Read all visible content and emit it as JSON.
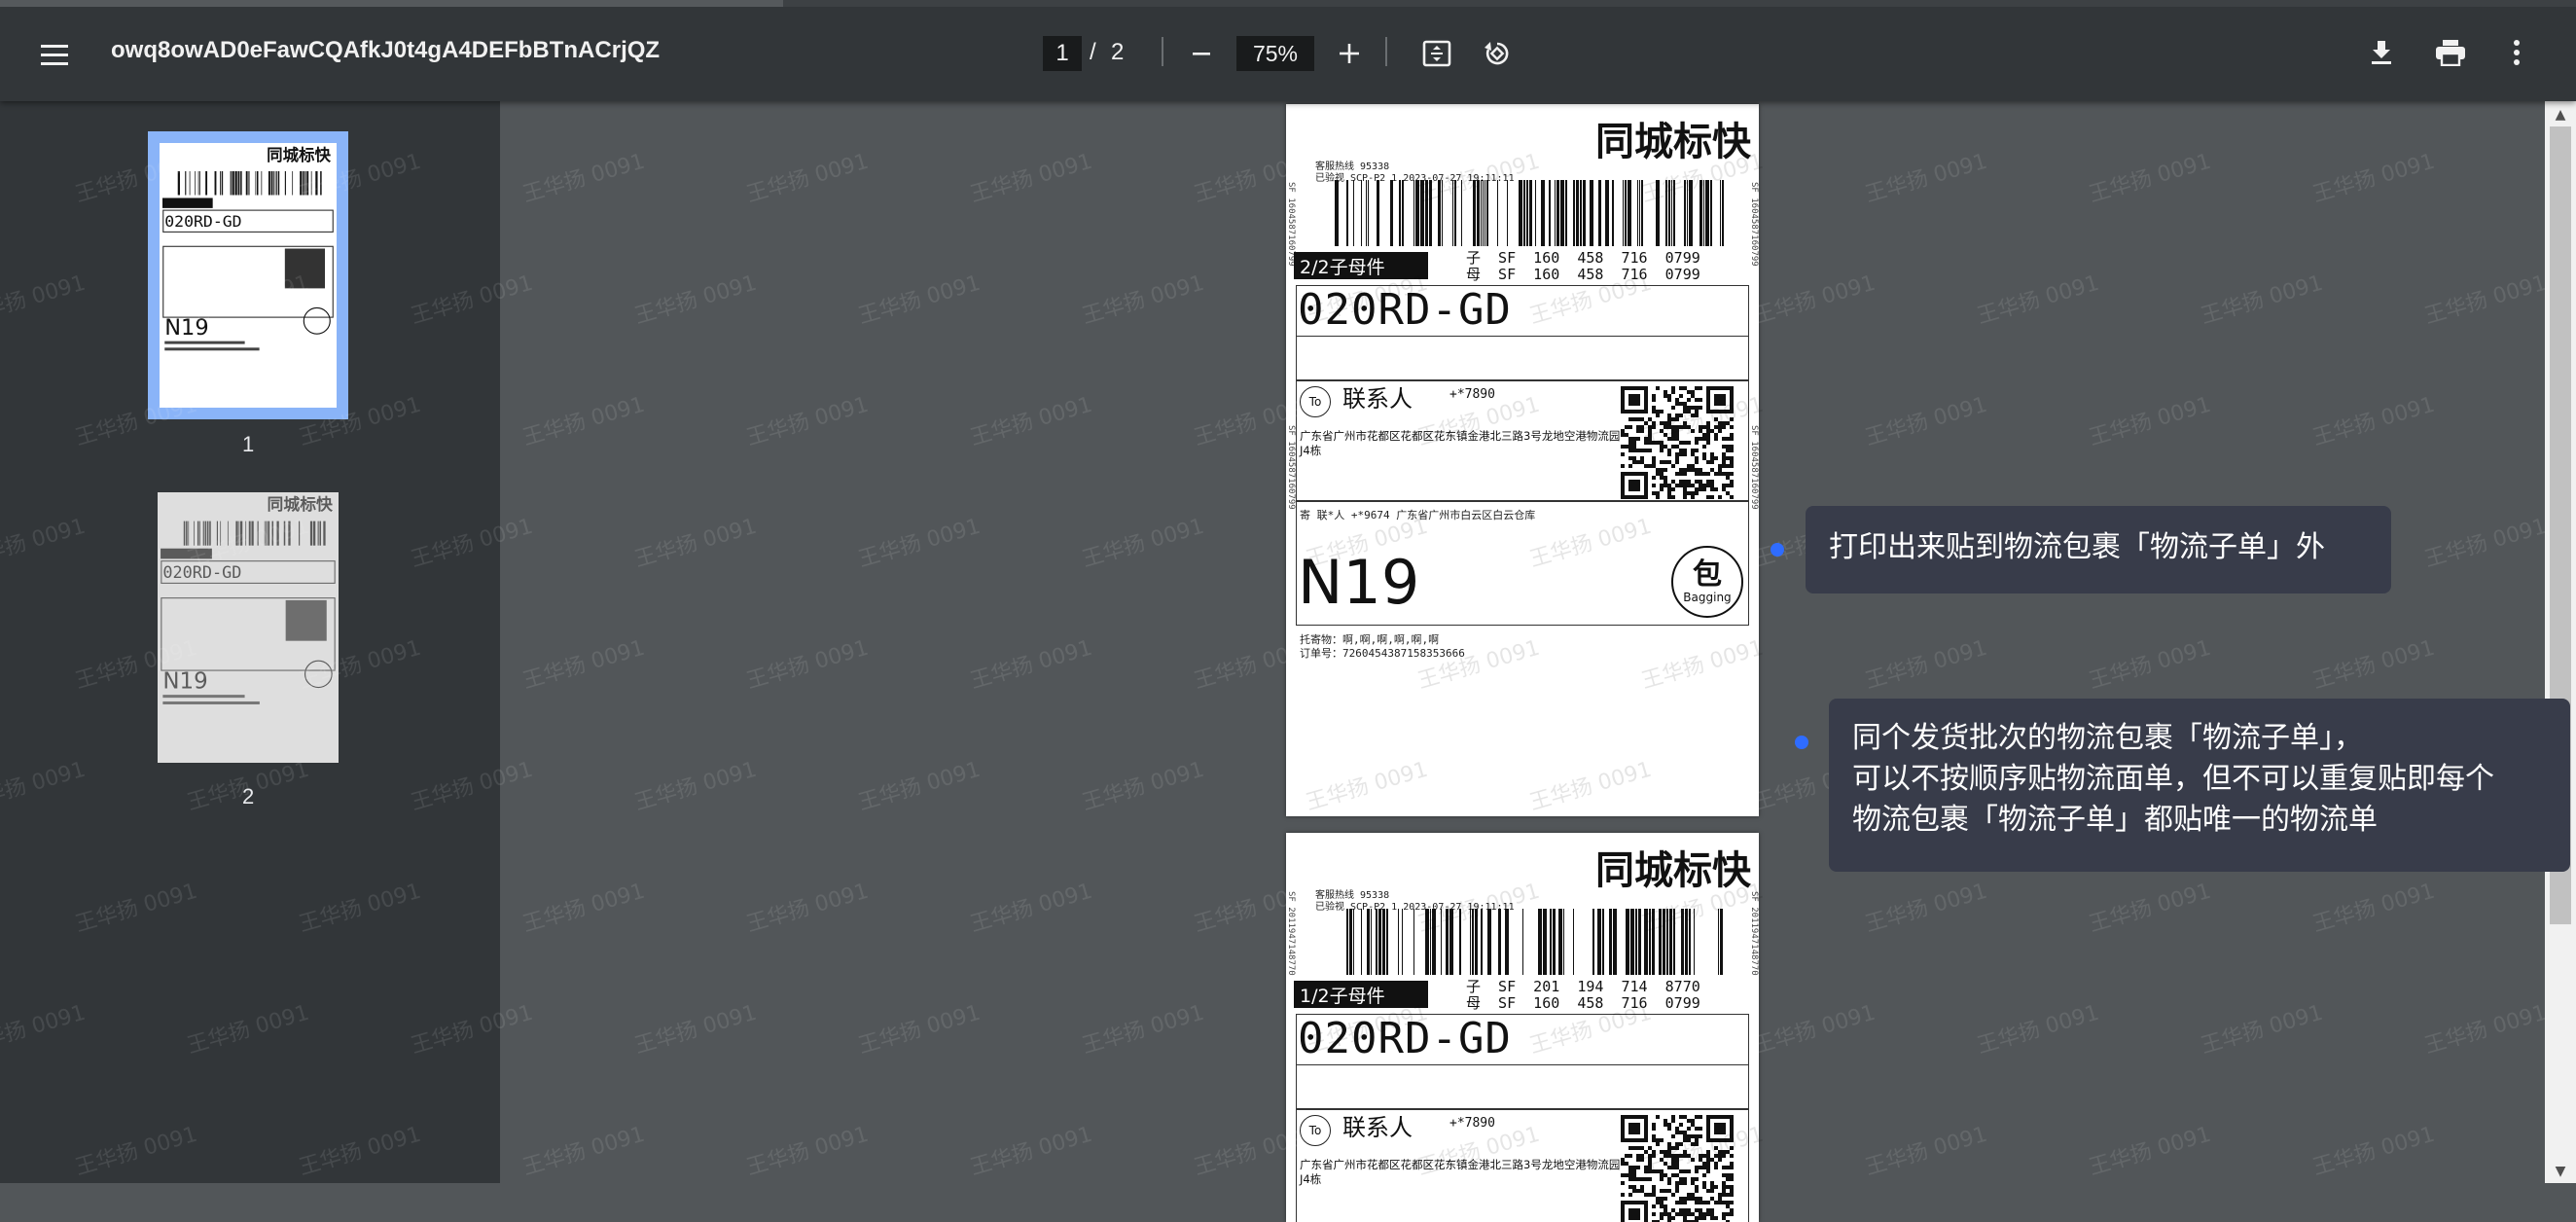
{
  "toolbar": {
    "menu_icon": "hamburger-menu-icon",
    "title": "owq8owAD0eFawCQAfkJ0t4gA4DEFbBTnACrjQZ",
    "current_page": "1",
    "page_separator": "/",
    "total_pages": "2",
    "zoom": "75%",
    "zoom_out_icon": "minus-icon",
    "zoom_in_icon": "plus-icon",
    "fit_icon": "fit-to-page-icon",
    "rotate_icon": "rotate-icon",
    "download_icon": "download-icon",
    "print_icon": "print-icon",
    "more_icon": "more-vertical-icon"
  },
  "sidebar": {
    "thumbnails": [
      {
        "label": "1",
        "selected": true
      },
      {
        "label": "2",
        "selected": false
      }
    ]
  },
  "pages": [
    {
      "header": "同城标快",
      "hotline": "客服热线  95338",
      "checked": "已验视  SCP-P2 1  2023-07-27  19:11:11",
      "tag": "2/2子母件",
      "child_no": "子  SF  160  458  716  0799",
      "mother_no": "母  SF  160  458  716  0799",
      "route_code": "020RD-GD",
      "to_label": "To",
      "contact": "联系人",
      "phone": "+*7890",
      "address": "广东省广州市花都区花都区花东镇金港北三路3号龙地空港物流园J4栋",
      "sender": "寄  联*人      +*9674    广东省广州市白云区白云仓库",
      "area_code": "N19",
      "bag_cn": "包",
      "bag_en": "Bagging",
      "goods": "托寄物：啊,啊,啊,啊,啊,啊",
      "order": "订单号：7260454387158353666",
      "side_left": "SF 1604587160799",
      "side_right": "SF 1604587160799"
    },
    {
      "header": "同城标快",
      "hotline": "客服热线  95338",
      "checked": "已验视  SCP-P2 1  2023-07-27  19:11:11",
      "tag": "1/2子母件",
      "child_no": "子  SF  201  194  714  8770",
      "mother_no": "母  SF  160  458  716  0799",
      "route_code": "020RD-GD",
      "to_label": "To",
      "contact": "联系人",
      "phone": "+*7890",
      "address": "广东省广州市花都区花都区花东镇金港北三路3号龙地空港物流园J4栋",
      "side_left": "SF 2011947148770",
      "side_right": "SF 2011947148770"
    }
  ],
  "tooltips": [
    {
      "text": "打印出来贴到物流包裹「物流子单」外"
    },
    {
      "lines": [
        "同个发货批次的物流包裹「物流子单」，",
        "可以不按顺序贴物流面单，但不可以重复贴即每个",
        "物流包裹「物流子单」都贴唯一的物流单"
      ]
    }
  ],
  "watermark": "王华扬 0091",
  "colors": {
    "toolbar_bg": "#323639",
    "viewer_bg": "#525659",
    "thumb_selected": "#8ab4f8",
    "tooltip_bg": "#383c4a",
    "tooltip_dot": "#2f6cff"
  }
}
